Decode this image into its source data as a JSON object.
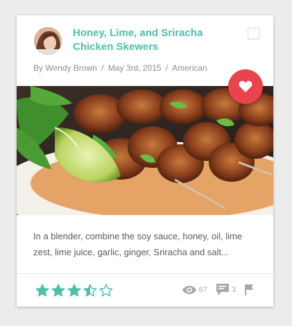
{
  "recipe": {
    "title": "Honey, Lime, and Sriracha Chicken Skewers",
    "author": "By Wendy Brown",
    "date": "May 3rd, 2015",
    "cuisine": "American",
    "meta_separator": "/",
    "description": "In a blender, combine the soy sauce, honey, oil, lime zest, lime juice, garlic, ginger, Sriracha and salt..."
  },
  "rating": {
    "value": 3.5,
    "max": 5
  },
  "stats": {
    "views": "67",
    "comments": "3"
  },
  "icons": {
    "favorite": "heart-icon",
    "bookmark": "checkbox-icon",
    "views": "eye-icon",
    "comments": "comment-icon",
    "flag": "flag-icon"
  },
  "colors": {
    "accent": "#4cbfa8",
    "favorite": "#e9434b",
    "muted": "#a9a9a9"
  }
}
